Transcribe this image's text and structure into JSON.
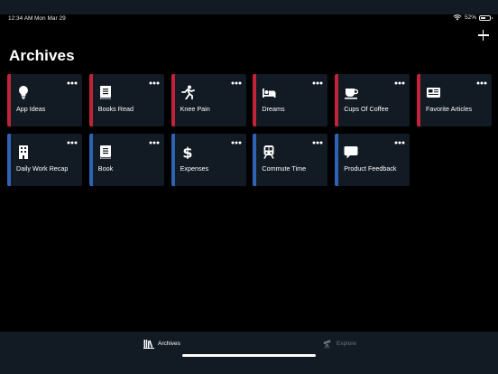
{
  "status": {
    "time": "12:34 AM",
    "date": "Mon Mar 29",
    "battery": "52%",
    "battery_level": 0.52
  },
  "header": {
    "title": "Archives",
    "add_icon": "plus-icon"
  },
  "colors": {
    "red_accent": "#c1233a",
    "blue_accent": "#2d63b4",
    "card_bg": "#121a24",
    "tab_bg": "#121a24"
  },
  "archives": [
    {
      "label": "App Ideas",
      "icon": "lightbulb-icon",
      "accent": "red"
    },
    {
      "label": "Books Read",
      "icon": "book-icon",
      "accent": "red"
    },
    {
      "label": "Knee Pain",
      "icon": "running-icon",
      "accent": "red"
    },
    {
      "label": "Dreams",
      "icon": "bed-icon",
      "accent": "red"
    },
    {
      "label": "Cups Of Coffee",
      "icon": "coffee-icon",
      "accent": "red"
    },
    {
      "label": "Favorite Articles",
      "icon": "newspaper-icon",
      "accent": "red"
    },
    {
      "label": "Daily Work Recap",
      "icon": "building-icon",
      "accent": "blue"
    },
    {
      "label": "Book",
      "icon": "book-icon",
      "accent": "blue"
    },
    {
      "label": "Expenses",
      "icon": "dollar-icon",
      "accent": "blue"
    },
    {
      "label": "Commute Time",
      "icon": "train-icon",
      "accent": "blue"
    },
    {
      "label": "Product Feedback",
      "icon": "speech-bubble-icon",
      "accent": "blue"
    }
  ],
  "tabs": [
    {
      "label": "Archives",
      "icon": "library-icon",
      "active": true
    },
    {
      "label": "Explore",
      "icon": "telescope-icon",
      "active": false
    }
  ]
}
